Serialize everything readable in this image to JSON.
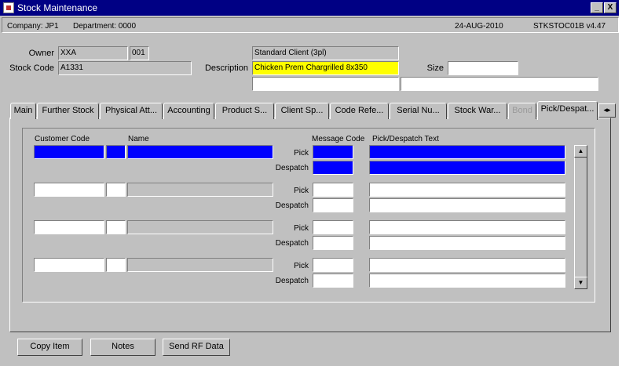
{
  "window": {
    "title": "Stock Maintenance",
    "minimize_label": "_",
    "close_label": "X"
  },
  "info": {
    "company": "Company:  JP1",
    "department": "Department:  0000",
    "date": "24-AUG-2010",
    "form": "STKSTOC01B  v4.47"
  },
  "header": {
    "owner_label": "Owner",
    "owner_value": "XXA",
    "owner_code": "001",
    "client_name": "Standard Client (3pl)",
    "stock_code_label": "Stock Code",
    "stock_code_value": "A1331",
    "description_label": "Description",
    "description_value": "Chicken Prem Chargrilled 8x350",
    "size_label": "Size",
    "size_value": ""
  },
  "tabs": [
    {
      "label": "Main"
    },
    {
      "label": "Further Stock"
    },
    {
      "label": "Physical Att..."
    },
    {
      "label": "Accounting"
    },
    {
      "label": "Product S..."
    },
    {
      "label": "Client Sp..."
    },
    {
      "label": "Code Refe..."
    },
    {
      "label": "Serial Nu..."
    },
    {
      "label": "Stock War..."
    },
    {
      "label": "Bond"
    },
    {
      "label": "Pick/Despat..."
    }
  ],
  "tab_scroll_label": "◂▸",
  "grid": {
    "col_customer_code": "Customer Code",
    "col_name": "Name",
    "col_message_code": "Message Code",
    "col_text": "Pick/Despatch Text",
    "pick_label": "Pick",
    "despatch_label": "Despatch"
  },
  "scroll": {
    "up": "▲",
    "down": "▼"
  },
  "buttons": {
    "copy_item": "Copy Item",
    "notes": "Notes",
    "send_rf": "Send RF Data"
  },
  "colors": {
    "title_bar": "#000084",
    "selected_row": "#0000ff",
    "highlight_field": "#ffff00"
  }
}
